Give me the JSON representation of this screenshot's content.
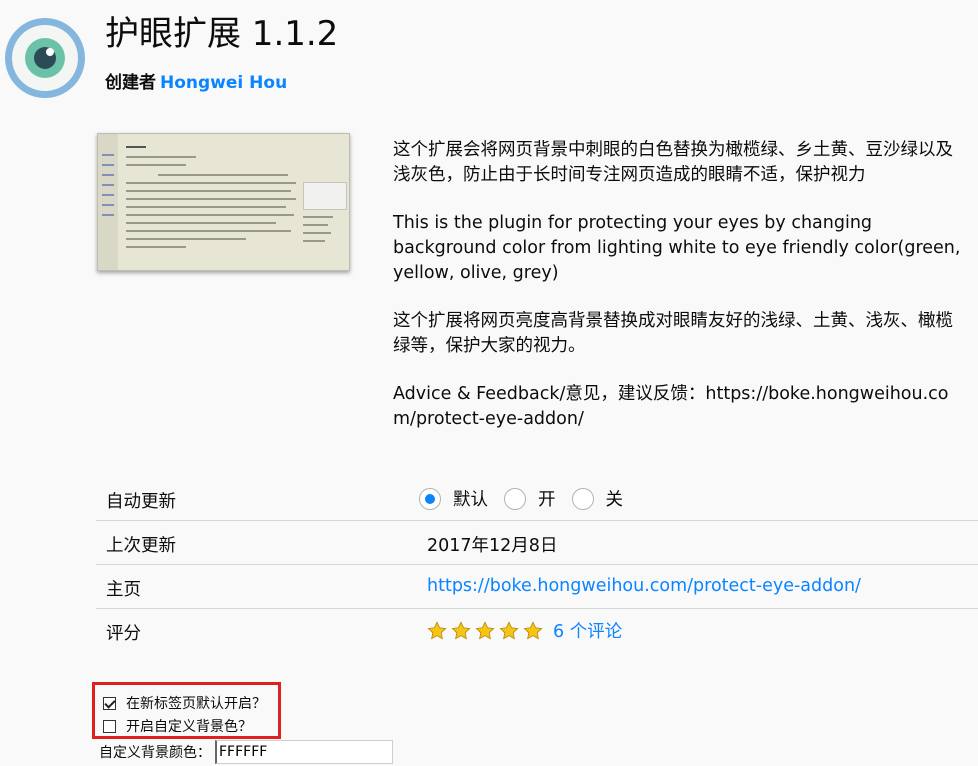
{
  "addon": {
    "title": "护眼扩展 1.1.2",
    "creator_label": "创建者",
    "creator_name": "Hongwei Hou"
  },
  "description": [
    "这个扩展会将网页背景中刺眼的白色替换为橄榄绿、乡土黄、豆沙绿以及浅灰色，防止由于长时间专注网页造成的眼睛不适，保护视力",
    "This is the plugin for protecting your eyes by changing background color from lighting white to eye friendly color(green, yellow, olive, grey)",
    "这个扩展将网页亮度高背景替换成对眼睛友好的浅绿、土黄、浅灰、橄榄绿等，保护大家的视力。",
    "Advice & Feedback/意见，建议反馈：https://boke.hongweihou.com/protect-eye-addon/"
  ],
  "details": {
    "auto_update": {
      "label": "自动更新",
      "options": [
        "默认",
        "开",
        "关"
      ],
      "selected": "默认"
    },
    "last_updated": {
      "label": "上次更新",
      "value": "2017年12月8日"
    },
    "homepage": {
      "label": "主页",
      "value": "https://boke.hongweihou.com/protect-eye-addon/"
    },
    "rating": {
      "label": "评分",
      "stars": 5,
      "reviews": "6 个评论"
    }
  },
  "preferences": {
    "new_tab_default": {
      "label": "在新标签页默认开启？",
      "checked": true
    },
    "custom_bg": {
      "label": "开启自定义背景色？",
      "checked": false
    },
    "custom_color": {
      "label": "自定义背景颜色：",
      "value": "FFFFFF"
    }
  },
  "colors": {
    "accent": "#0a84ff",
    "highlight_border": "#e02020",
    "icon_ring": "#7fb0d8",
    "icon_iris": "#6cc2a8"
  },
  "icons": {
    "addon": "eye-icon",
    "star": "star-icon"
  }
}
